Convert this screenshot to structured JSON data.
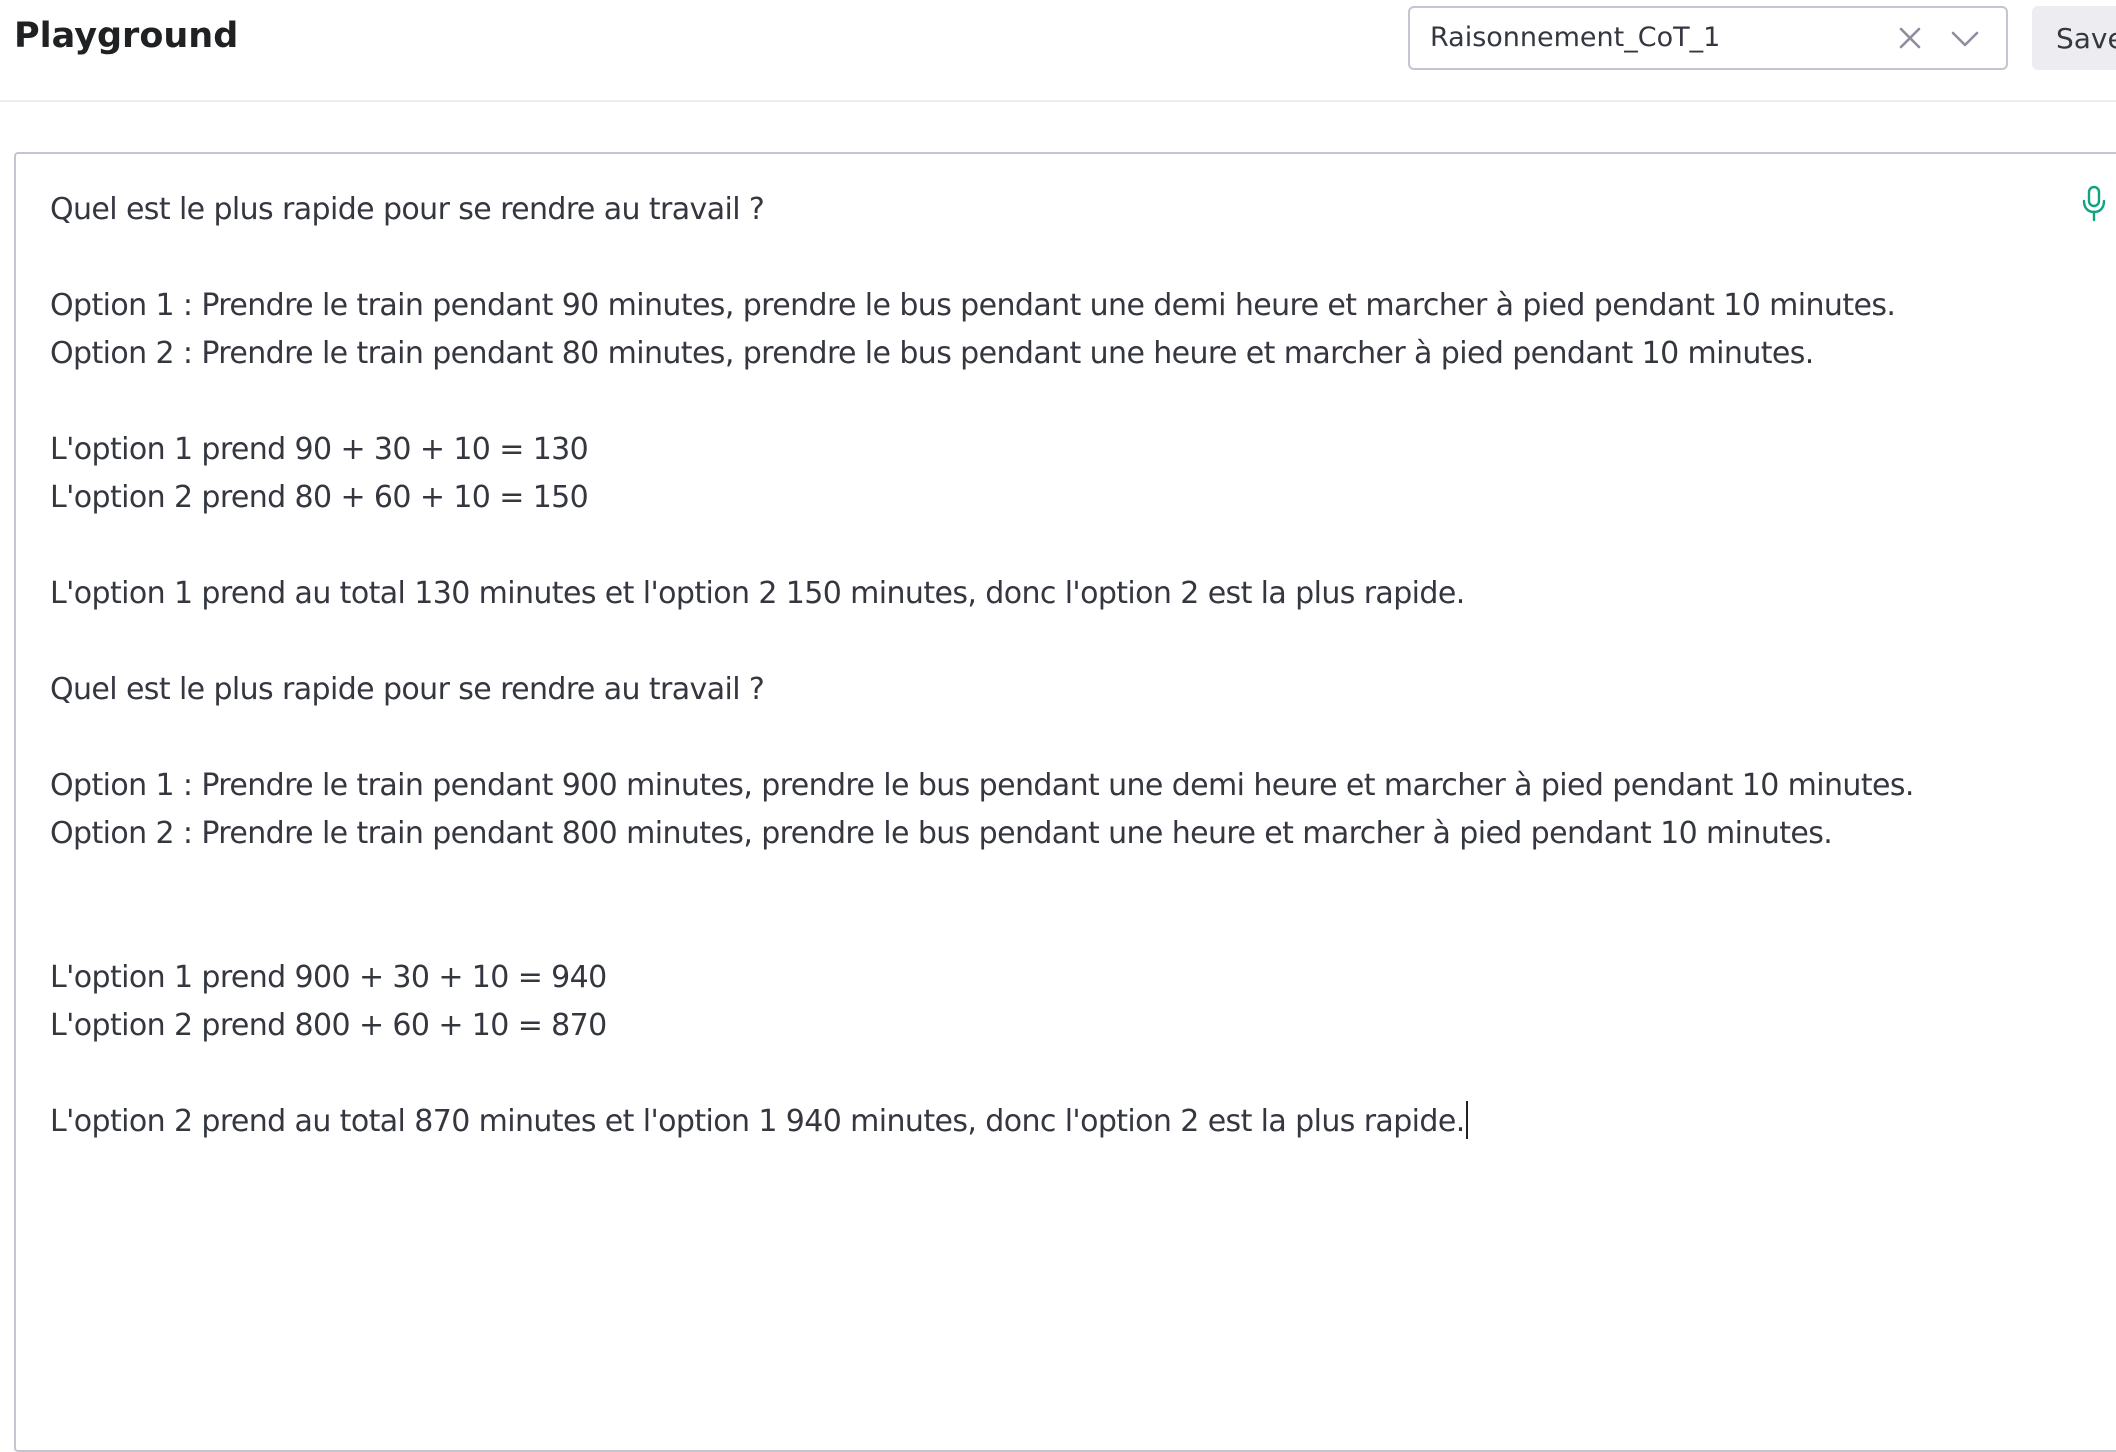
{
  "header": {
    "title": "Playground",
    "preset": {
      "value": "Raisonnement_CoT_1"
    },
    "save_label": "Save"
  },
  "editor": {
    "text": "Quel est le plus rapide pour se rendre au travail ?\n\nOption 1 : Prendre le train pendant 90 minutes, prendre le bus pendant une demi heure et marcher à pied pendant 10 minutes.\nOption 2 : Prendre le train pendant 80 minutes, prendre le bus pendant une heure et marcher à pied pendant 10 minutes.\n\nL'option 1 prend 90 + 30 + 10 = 130\nL'option 2 prend 80 + 60 + 10 = 150\n\nL'option 1 prend au total 130 minutes et l'option 2 150 minutes, donc l'option 2 est la plus rapide.\n\nQuel est le plus rapide pour se rendre au travail ?\n\nOption 1 : Prendre le train pendant 900 minutes, prendre le bus pendant une demi heure et marcher à pied pendant 10 minutes.\nOption 2 : Prendre le train pendant 800 minutes, prendre le bus pendant une heure et marcher à pied pendant 10 minutes.\n\n\nL'option 1 prend 900 + 30 + 10 = 940\nL'option 2 prend 800 + 60 + 10 = 870\n\nL'option 2 prend au total 870 minutes et l'option 1 940 minutes, donc l'option 2 est la plus rapide."
  },
  "icons": {
    "clear": "close-icon",
    "dropdown": "chevron-down-icon",
    "mic": "microphone-icon"
  },
  "colors": {
    "accent": "#10a37f",
    "text": "#353740",
    "border": "#c5c5d2",
    "button_bg": "#ececf1"
  }
}
